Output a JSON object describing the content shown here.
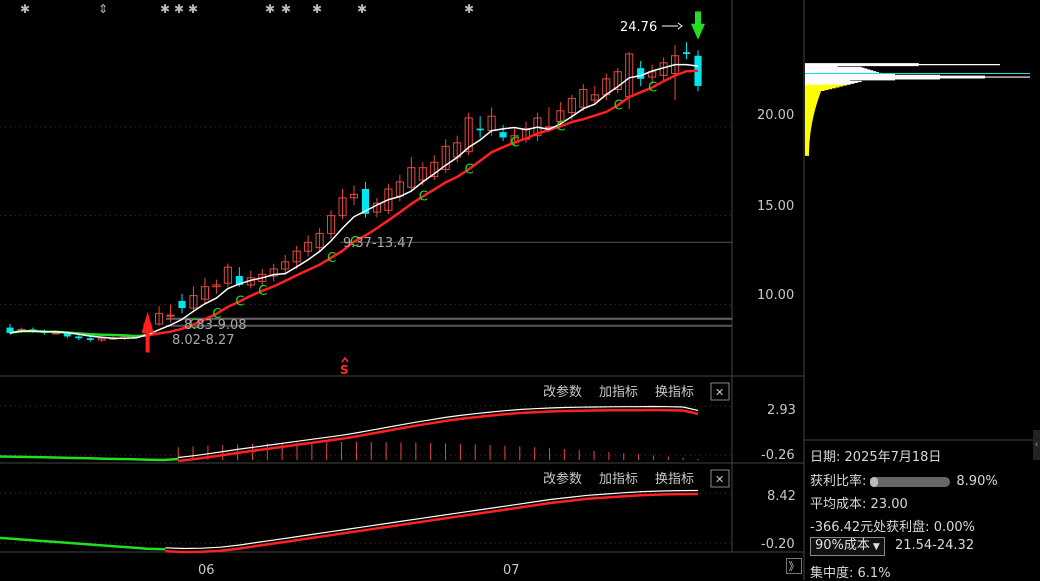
{
  "chart_data": [
    {
      "type": "candlestick",
      "panel": "price",
      "y_ticks": [
        "20.00",
        "15.00",
        "10.00"
      ],
      "ylim": [
        6.2,
        26.8
      ],
      "x_labels": [
        "06",
        "07"
      ],
      "grid": true,
      "annotations": {
        "high_label": "24.76",
        "zone_upper": "9.37-13.47",
        "zone_mid": "8.83-9.08",
        "zone_low": "8.02-8.27",
        "signal_letter": "C",
        "s_marker": "S"
      },
      "candles": [
        {
          "o": 8.7,
          "c": 8.4,
          "h": 8.9,
          "l": 8.3
        },
        {
          "o": 8.5,
          "c": 8.6,
          "h": 8.7,
          "l": 8.4
        },
        {
          "o": 8.6,
          "c": 8.5,
          "h": 8.7,
          "l": 8.4
        },
        {
          "o": 8.5,
          "c": 8.4,
          "h": 8.6,
          "l": 8.3
        },
        {
          "o": 8.4,
          "c": 8.4,
          "h": 8.5,
          "l": 8.3
        },
        {
          "o": 8.4,
          "c": 8.2,
          "h": 8.5,
          "l": 8.1
        },
        {
          "o": 8.2,
          "c": 8.1,
          "h": 8.3,
          "l": 8.0
        },
        {
          "o": 8.1,
          "c": 8.0,
          "h": 8.2,
          "l": 7.9
        },
        {
          "o": 8.0,
          "c": 8.1,
          "h": 8.2,
          "l": 7.9
        },
        {
          "o": 8.1,
          "c": 8.1,
          "h": 8.2,
          "l": 8.0
        },
        {
          "o": 8.1,
          "c": 8.2,
          "h": 8.3,
          "l": 8.0
        },
        {
          "o": 8.2,
          "c": 8.2,
          "h": 8.3,
          "l": 8.1
        },
        {
          "o": 8.3,
          "c": 8.9,
          "h": 9.0,
          "l": 8.2
        },
        {
          "o": 8.9,
          "c": 9.5,
          "h": 9.9,
          "l": 8.8
        },
        {
          "o": 9.4,
          "c": 9.4,
          "h": 10.0,
          "l": 9.0
        },
        {
          "o": 10.2,
          "c": 9.8,
          "h": 10.6,
          "l": 9.5
        },
        {
          "o": 9.8,
          "c": 10.5,
          "h": 11.0,
          "l": 9.6
        },
        {
          "o": 10.3,
          "c": 11.0,
          "h": 11.5,
          "l": 10.1
        },
        {
          "o": 11.0,
          "c": 11.1,
          "h": 11.4,
          "l": 10.6
        },
        {
          "o": 11.2,
          "c": 12.1,
          "h": 12.3,
          "l": 11.0
        },
        {
          "o": 11.6,
          "c": 11.1,
          "h": 12.1,
          "l": 11.0
        },
        {
          "o": 11.1,
          "c": 11.5,
          "h": 11.9,
          "l": 10.9
        },
        {
          "o": 11.3,
          "c": 11.7,
          "h": 12.0,
          "l": 11.0
        },
        {
          "o": 11.6,
          "c": 12.0,
          "h": 12.3,
          "l": 11.3
        },
        {
          "o": 12.0,
          "c": 12.4,
          "h": 12.8,
          "l": 11.7
        },
        {
          "o": 12.4,
          "c": 13.0,
          "h": 13.3,
          "l": 12.0
        },
        {
          "o": 13.0,
          "c": 13.5,
          "h": 13.9,
          "l": 12.7
        },
        {
          "o": 13.2,
          "c": 14.0,
          "h": 14.3,
          "l": 13.0
        },
        {
          "o": 14.0,
          "c": 15.0,
          "h": 15.3,
          "l": 13.7
        },
        {
          "o": 15.0,
          "c": 16.0,
          "h": 16.5,
          "l": 14.8
        },
        {
          "o": 16.0,
          "c": 16.2,
          "h": 16.7,
          "l": 15.6
        },
        {
          "o": 16.5,
          "c": 15.1,
          "h": 16.9,
          "l": 14.9
        },
        {
          "o": 15.2,
          "c": 15.7,
          "h": 16.0,
          "l": 14.9
        },
        {
          "o": 15.3,
          "c": 16.5,
          "h": 16.8,
          "l": 15.1
        },
        {
          "o": 16.1,
          "c": 16.9,
          "h": 17.3,
          "l": 15.8
        },
        {
          "o": 16.6,
          "c": 17.7,
          "h": 18.3,
          "l": 16.4
        },
        {
          "o": 17.0,
          "c": 17.7,
          "h": 18.0,
          "l": 16.7
        },
        {
          "o": 17.2,
          "c": 18.0,
          "h": 18.4,
          "l": 17.0
        },
        {
          "o": 17.6,
          "c": 18.9,
          "h": 19.3,
          "l": 17.4
        },
        {
          "o": 18.3,
          "c": 19.1,
          "h": 19.5,
          "l": 18.0
        },
        {
          "o": 18.6,
          "c": 20.5,
          "h": 20.8,
          "l": 18.4
        },
        {
          "o": 19.9,
          "c": 19.8,
          "h": 20.6,
          "l": 19.4
        },
        {
          "o": 19.8,
          "c": 20.6,
          "h": 21.1,
          "l": 19.5
        },
        {
          "o": 19.7,
          "c": 19.4,
          "h": 20.1,
          "l": 19.2
        },
        {
          "o": 19.1,
          "c": 19.5,
          "h": 19.9,
          "l": 18.9
        },
        {
          "o": 19.3,
          "c": 19.9,
          "h": 20.3,
          "l": 19.1
        },
        {
          "o": 19.5,
          "c": 20.5,
          "h": 20.8,
          "l": 19.2
        },
        {
          "o": 20.0,
          "c": 20.0,
          "h": 21.1,
          "l": 19.7
        },
        {
          "o": 20.3,
          "c": 20.9,
          "h": 21.4,
          "l": 20.0
        },
        {
          "o": 20.8,
          "c": 21.6,
          "h": 21.8,
          "l": 20.4
        },
        {
          "o": 21.1,
          "c": 22.1,
          "h": 22.4,
          "l": 20.9
        },
        {
          "o": 21.5,
          "c": 21.8,
          "h": 22.3,
          "l": 21.2
        },
        {
          "o": 21.8,
          "c": 22.7,
          "h": 23.0,
          "l": 21.5
        },
        {
          "o": 22.1,
          "c": 23.1,
          "h": 23.3,
          "l": 21.9
        },
        {
          "o": 21.7,
          "c": 24.1,
          "h": 24.2,
          "l": 21.0
        },
        {
          "o": 23.3,
          "c": 22.7,
          "h": 23.7,
          "l": 22.3
        },
        {
          "o": 22.8,
          "c": 23.1,
          "h": 23.5,
          "l": 22.4
        },
        {
          "o": 22.9,
          "c": 23.6,
          "h": 23.9,
          "l": 22.5
        },
        {
          "o": 23.0,
          "c": 24.0,
          "h": 24.6,
          "l": 21.5
        },
        {
          "o": 24.2,
          "c": 24.1,
          "h": 24.76,
          "l": 23.8
        },
        {
          "o": 24.0,
          "c": 22.3,
          "h": 24.3,
          "l": 22.0
        }
      ]
    },
    {
      "type": "line",
      "panel": "indicator-1",
      "y_ticks": [
        "2.93",
        "-0.26"
      ],
      "series": [
        {
          "values": [
            0.05,
            0.03,
            0.02,
            0.0,
            -0.02,
            -0.04,
            -0.06,
            -0.08,
            -0.1,
            -0.12,
            -0.14,
            -0.16,
            -0.1,
            0.0,
            0.12,
            0.25,
            0.38,
            0.5,
            0.62,
            0.74,
            0.86,
            0.98,
            1.1,
            1.22,
            1.36,
            1.52,
            1.68,
            1.84,
            2.0,
            2.14,
            2.28,
            2.4,
            2.5,
            2.6,
            2.68,
            2.75,
            2.8,
            2.84,
            2.87,
            2.89,
            2.9,
            2.91,
            2.92,
            2.92,
            2.93,
            2.92,
            2.9,
            2.7
          ]
        }
      ]
    },
    {
      "type": "line",
      "panel": "indicator-2",
      "y_ticks": [
        "8.42",
        "-0.20"
      ],
      "series": [
        {
          "values": [
            1.6,
            1.4,
            1.2,
            1.0,
            0.8,
            0.6,
            0.4,
            0.2,
            0.0,
            -0.1,
            -0.2,
            -0.15,
            0.0,
            0.3,
            0.7,
            1.1,
            1.5,
            1.9,
            2.3,
            2.7,
            3.1,
            3.5,
            3.9,
            4.3,
            4.7,
            5.1,
            5.5,
            5.9,
            6.3,
            6.7,
            7.1,
            7.4,
            7.7,
            7.9,
            8.1,
            8.25,
            8.35,
            8.4,
            8.42
          ]
        }
      ]
    },
    {
      "type": "histogram",
      "panel": "chip-distribution",
      "price_range": [
        18.4,
        23.6
      ]
    }
  ],
  "controls": {
    "change_params": "改参数",
    "add_indicator": "加指标",
    "switch_indicator": "换指标",
    "close": "✕",
    "expand": "》"
  },
  "info": {
    "date_label": "日期:",
    "date_value": "2025年7月18日",
    "profit_ratio_label": "获利比率:",
    "profit_ratio_value": "8.90%",
    "profit_ratio_fraction": 0.089,
    "avg_cost_label": "平均成本:",
    "avg_cost_value": "23.00",
    "price_profit_label": "-366.42元处获利盘:",
    "price_profit_value": "0.00%",
    "cost_select": "90%成本",
    "cost_range": "21.54-24.32",
    "concentration_label": "集中度:",
    "concentration_value": "6.1%"
  },
  "colors": {
    "up": "#e8493f",
    "down": "#00e6f0",
    "ma_fast": "#ffffff",
    "ma_slow": "#ff2020",
    "signal": "#22dd22",
    "chip": "#ffffff",
    "chip_profit": "#ffff00",
    "grid": "#5a2a2a"
  }
}
